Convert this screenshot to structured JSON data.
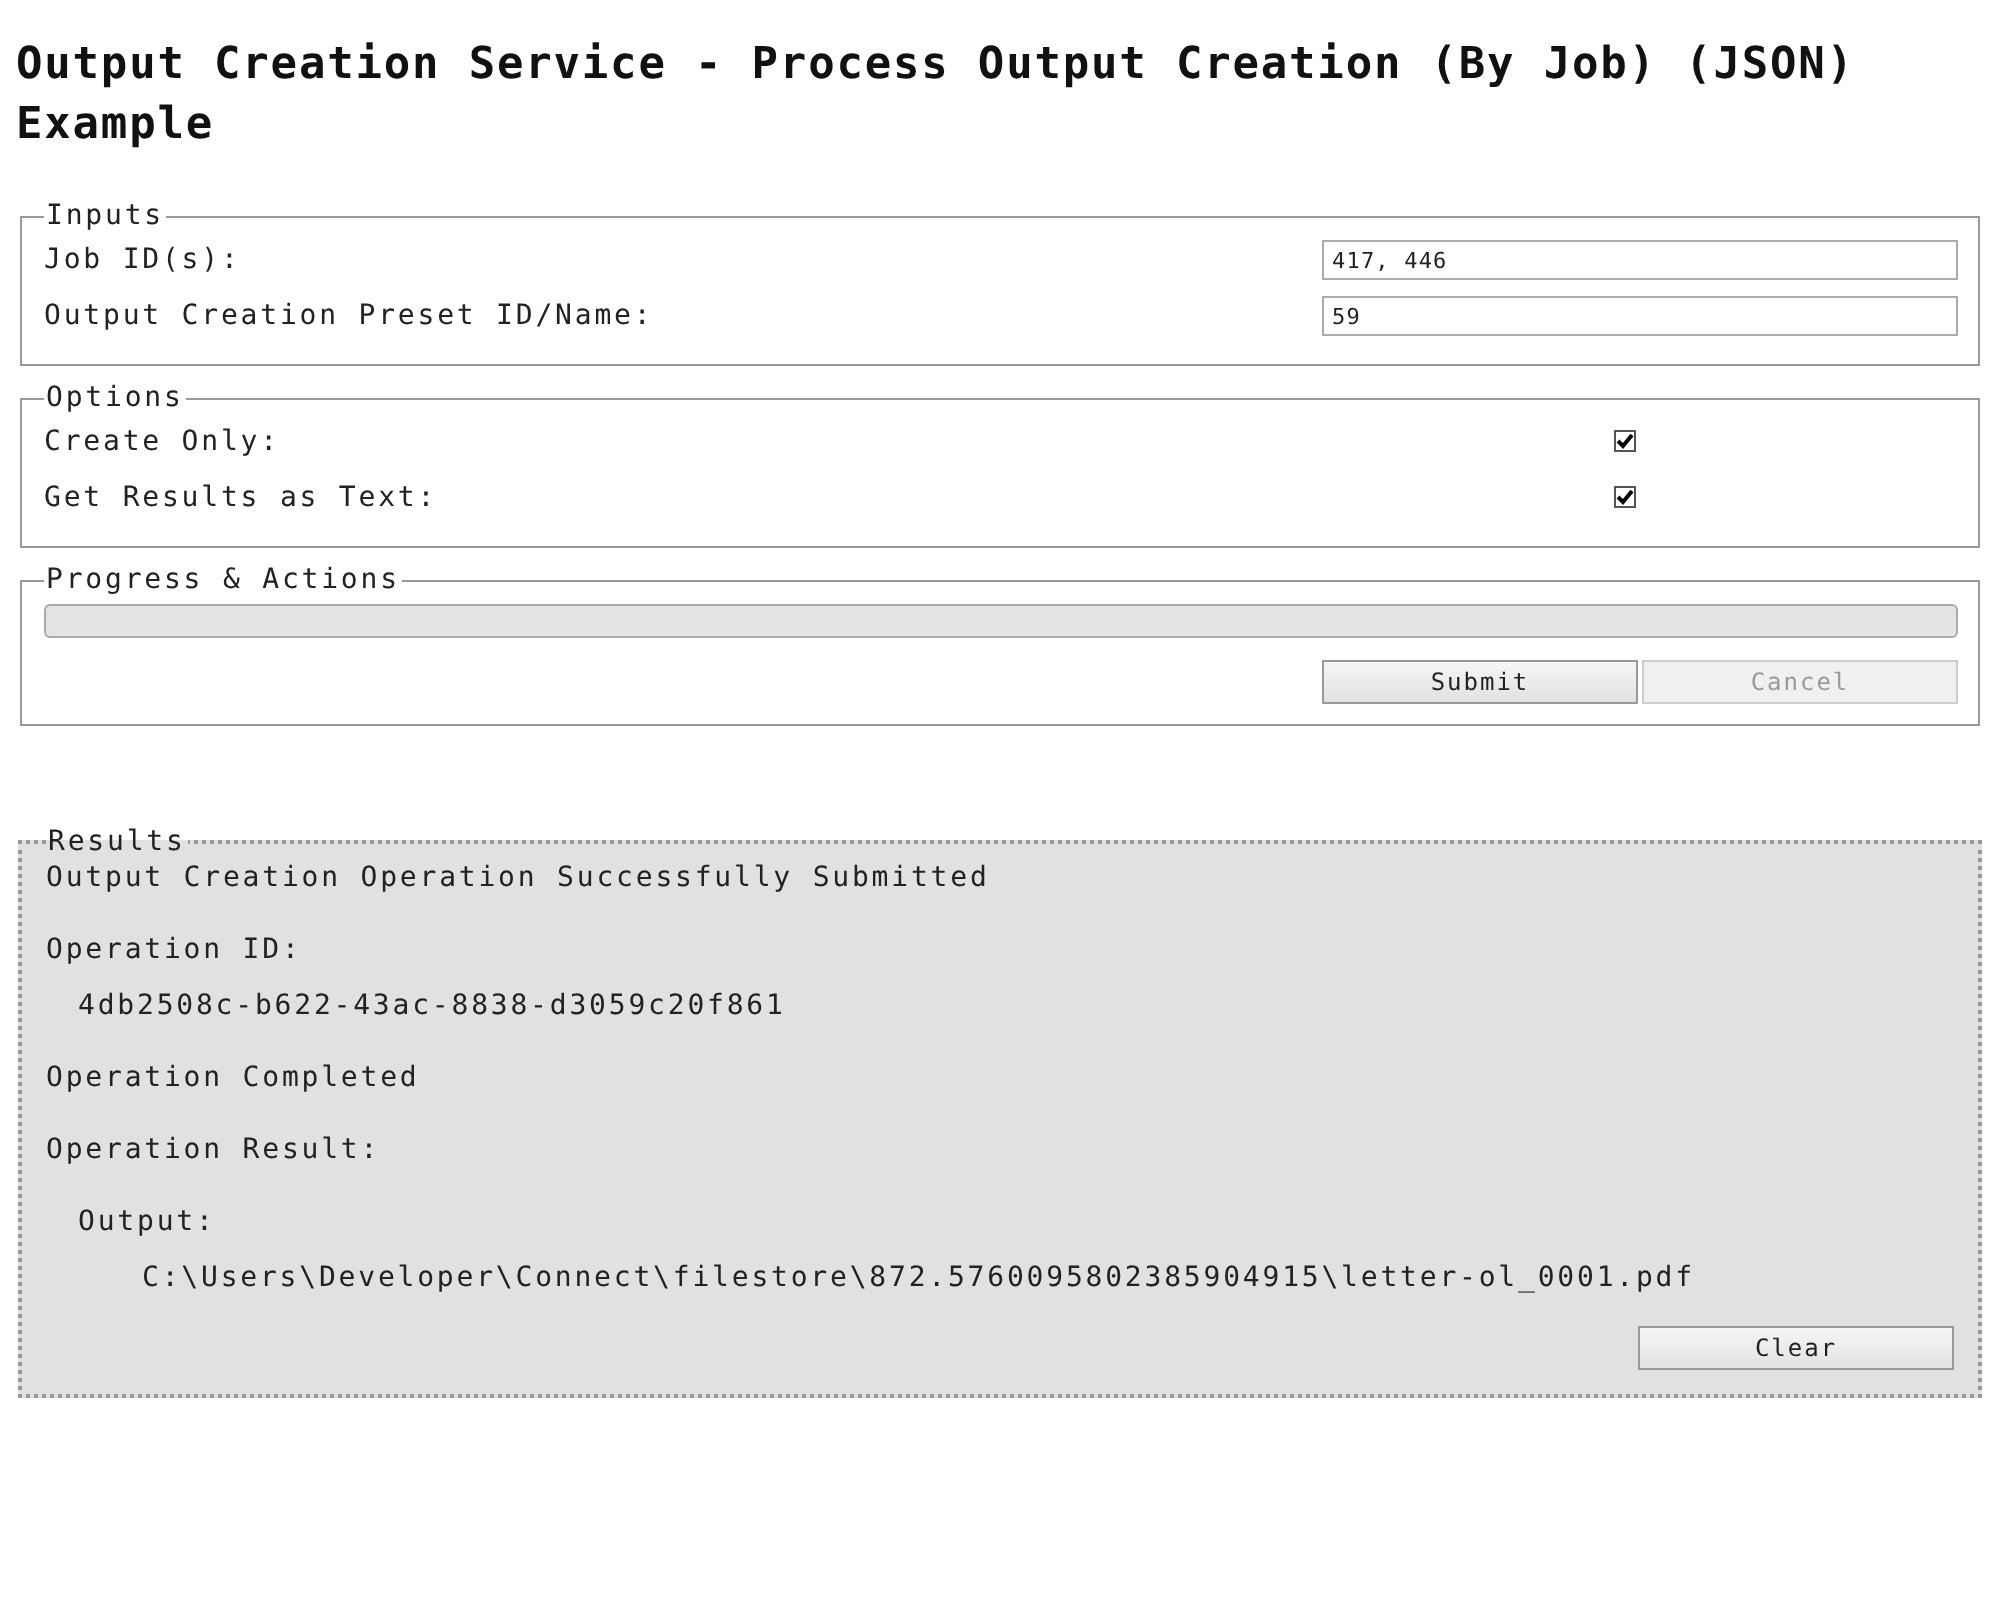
{
  "title": "Output Creation Service - Process Output Creation (By Job) (JSON) Example",
  "inputs": {
    "legend": "Inputs",
    "fields": [
      {
        "label": "Job ID(s):",
        "value": "417, 446"
      },
      {
        "label": "Output Creation Preset ID/Name:",
        "value": "59"
      }
    ]
  },
  "options": {
    "legend": "Options",
    "items": [
      {
        "label": "Create Only:",
        "checked": true
      },
      {
        "label": "Get Results as Text:",
        "checked": true
      }
    ]
  },
  "progress": {
    "legend": "Progress & Actions",
    "level": 0,
    "buttons": [
      {
        "label": "Submit",
        "disabled": false
      },
      {
        "label": "Cancel",
        "disabled": true
      }
    ]
  },
  "results": {
    "legend": "Results",
    "lines": [
      {
        "kind": "message",
        "text": "Output Creation Operation Successfully Submitted"
      },
      {
        "kind": "label",
        "text": "Operation ID:"
      },
      {
        "kind": "value",
        "text": "4db2508c-b622-43ac-8838-d3059c20f861"
      },
      {
        "kind": "label",
        "text": "Operation Completed"
      },
      {
        "kind": "label",
        "text": "Operation Result:"
      },
      {
        "kind": "sublabel",
        "text": "Output:"
      },
      {
        "kind": "path",
        "text": "C:\\Users\\Developer\\Connect\\filestore\\872.5760095802385904915\\letter-ol_0001.pdf"
      }
    ],
    "button": {
      "label": "Clear",
      "disabled": false
    }
  }
}
